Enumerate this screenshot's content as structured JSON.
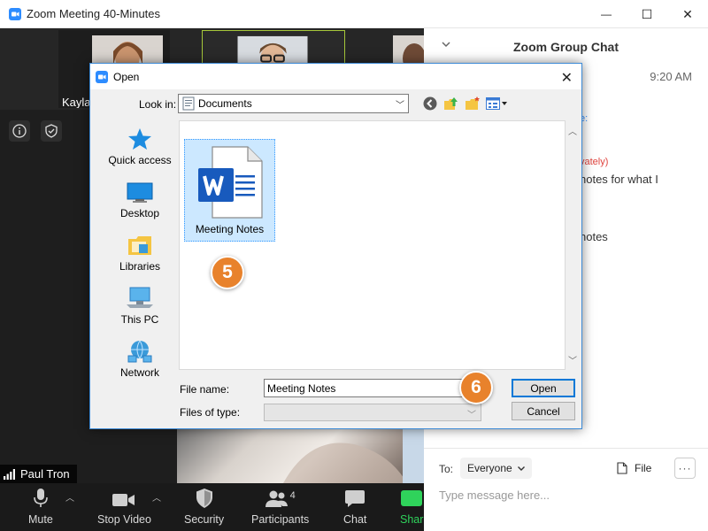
{
  "window": {
    "title": "Zoom Meeting 40-Minutes",
    "minimize_glyph": "—",
    "maximize_glyph": "☐",
    "close_glyph": "✕"
  },
  "gallery": {
    "participant_name": "Kayla"
  },
  "speaker": {
    "name_tag": "Paul Tron"
  },
  "toolbar": {
    "mute_label": "Mute",
    "stop_video_label": "Stop Video",
    "security_label": "Security",
    "participants_label": "Participants",
    "participants_count": "4",
    "chat_label": "Chat",
    "share_label": "Shar"
  },
  "chat": {
    "header": "Zoom Group Chat",
    "time": "9:20 AM",
    "fragment_1": "e:",
    "fragment_2": "vately)",
    "fragment_3": "notes for what I",
    "fragment_4": "notes",
    "to_label": "To:",
    "recipient": "Everyone",
    "file_label": "File",
    "more_label": "···",
    "input_placeholder": "Type message here..."
  },
  "dialog": {
    "title": "Open",
    "close_glyph": "✕",
    "look_in_label": "Look in:",
    "look_in_value": "Documents",
    "places": [
      {
        "label": "Quick access"
      },
      {
        "label": "Desktop"
      },
      {
        "label": "Libraries"
      },
      {
        "label": "This PC"
      },
      {
        "label": "Network"
      }
    ],
    "file_item_name": "Meeting Notes",
    "file_name_label": "File name:",
    "file_name_value": "Meeting Notes",
    "files_of_type_label": "Files of type:",
    "open_button": "Open",
    "cancel_button": "Cancel"
  },
  "callouts": {
    "step_5": "5",
    "step_6": "6"
  },
  "colors": {
    "accent": "#0078d7",
    "callout": "#e8822c",
    "zoom_blue": "#2d8cff",
    "word_blue": "#185abd",
    "selection": "#cce8ff",
    "chat_private": "#e0443e"
  },
  "icons": {
    "app": "zoom-icon",
    "mic": "microphone-icon",
    "video": "video-camera-icon",
    "security": "shield-icon",
    "participants": "people-icon",
    "chat": "chat-bubble-icon",
    "word": "word-document-icon"
  }
}
